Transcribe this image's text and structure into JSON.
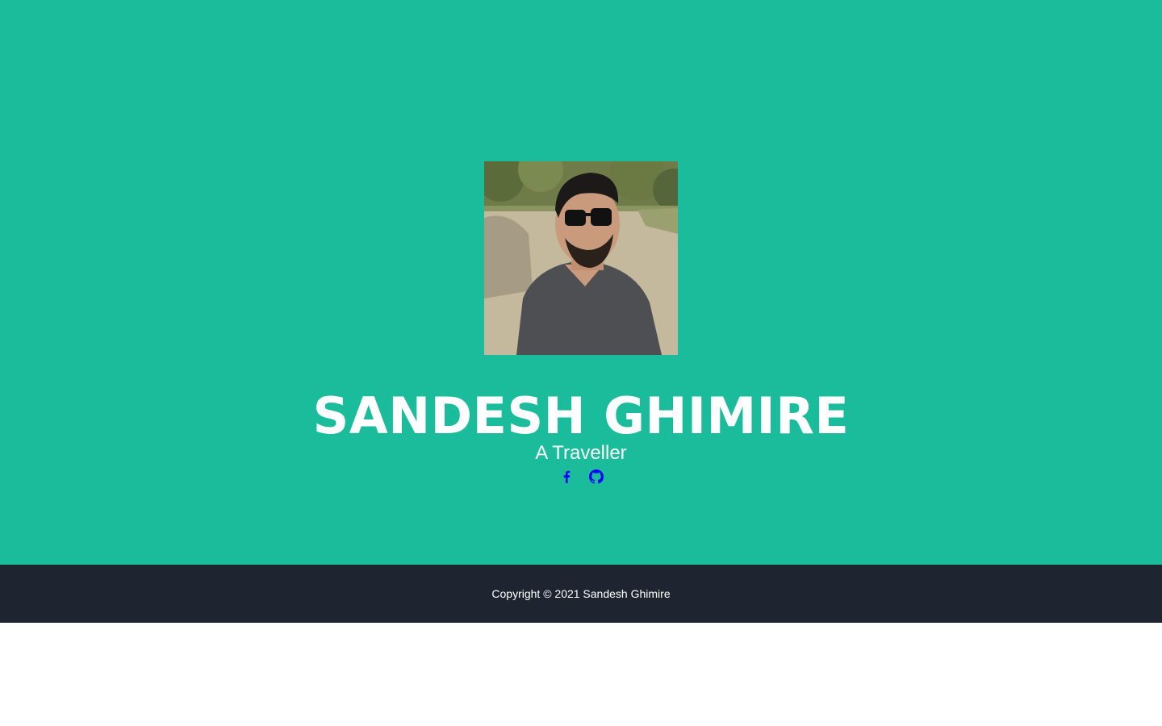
{
  "hero": {
    "name": "SANDESH GHIMIRE",
    "tagline": "A Traveller",
    "background_color": "#1abc9c"
  },
  "socials": [
    {
      "icon": "facebook-icon",
      "color": "#0000ff"
    },
    {
      "icon": "github-icon",
      "color": "#0000ff"
    }
  ],
  "footer": {
    "copyright": "Copyright © 2021 Sandesh Ghimire",
    "background_color": "#1e2530"
  }
}
